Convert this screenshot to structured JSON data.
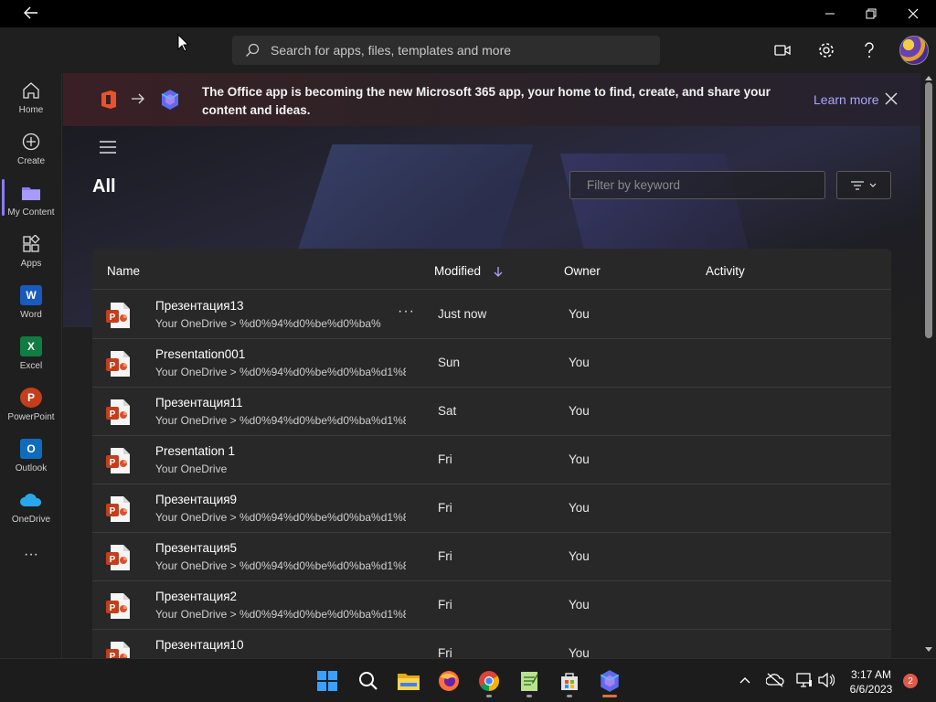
{
  "search": {
    "placeholder": "Search for apps, files, templates and more"
  },
  "sidebar": {
    "items": [
      {
        "label": "Home",
        "icon": "home-icon"
      },
      {
        "label": "Create",
        "icon": "plus-circle-icon"
      },
      {
        "label": "My Content",
        "icon": "folder-icon"
      },
      {
        "label": "Apps",
        "icon": "apps-icon"
      },
      {
        "label": "Word",
        "icon": "word-icon"
      },
      {
        "label": "Excel",
        "icon": "excel-icon"
      },
      {
        "label": "PowerPoint",
        "icon": "powerpoint-icon"
      },
      {
        "label": "Outlook",
        "icon": "outlook-icon"
      },
      {
        "label": "OneDrive",
        "icon": "onedrive-icon"
      }
    ],
    "more": "···",
    "active_color": "#8b7cf6"
  },
  "banner": {
    "text": "The Office app is becoming the new Microsoft 365 app, your home to find, create, and share your content and ideas.",
    "learn_more": "Learn more"
  },
  "main": {
    "title": "All",
    "filter": {
      "placeholder": "Filter by keyword"
    }
  },
  "table": {
    "columns": {
      "name": "Name",
      "modified": "Modified",
      "owner": "Owner",
      "activity": "Activity"
    },
    "rows": [
      {
        "name": "Презентация13",
        "path": "Your OneDrive > %d0%94%d0%be%d0%ba%",
        "modified": "Just now",
        "owner": "You",
        "more": "···"
      },
      {
        "name": "Presentation001",
        "path": "Your OneDrive > %d0%94%d0%be%d0%ba%d1%8",
        "modified": "Sun",
        "owner": "You"
      },
      {
        "name": "Презентация11",
        "path": "Your OneDrive > %d0%94%d0%be%d0%ba%d1%8",
        "modified": "Sat",
        "owner": "You"
      },
      {
        "name": "Presentation 1",
        "path": "Your OneDrive",
        "modified": "Fri",
        "owner": "You"
      },
      {
        "name": "Презентация9",
        "path": "Your OneDrive > %d0%94%d0%be%d0%ba%d1%8",
        "modified": "Fri",
        "owner": "You"
      },
      {
        "name": "Презентация5",
        "path": "Your OneDrive > %d0%94%d0%be%d0%ba%d1%8",
        "modified": "Fri",
        "owner": "You"
      },
      {
        "name": "Презентация2",
        "path": "Your OneDrive > %d0%94%d0%be%d0%ba%d1%8",
        "modified": "Fri",
        "owner": "You"
      },
      {
        "name": "Презентация10",
        "path": "",
        "modified": "Fri",
        "owner": "You"
      }
    ]
  },
  "taskbar": {
    "time": "3:17 AM",
    "date": "6/6/2023",
    "notifications": "2"
  },
  "colors": {
    "accent": "#8b7cf6",
    "link": "#a8a6ff",
    "powerpoint": "#c43e1c",
    "word": "#185abd",
    "excel": "#107c41",
    "outlook": "#0f6cbd",
    "onedrive": "#28a8ea"
  }
}
